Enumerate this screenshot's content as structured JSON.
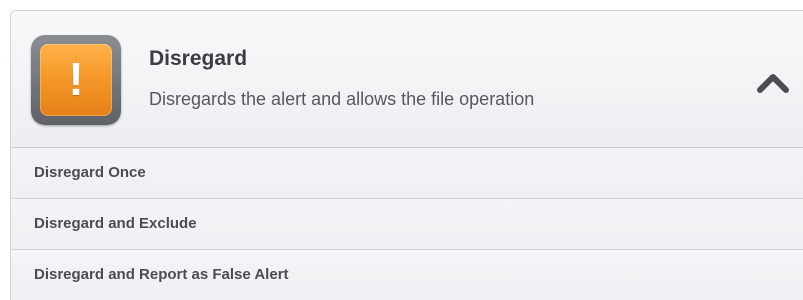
{
  "action": {
    "title": "Disregard",
    "description": "Disregards the alert and allows the file operation",
    "icon": "exclamation-warning-icon",
    "icon_glyph": "!",
    "expanded": true,
    "collapse_icon": "chevron-up-icon"
  },
  "options": [
    {
      "label": "Disregard Once"
    },
    {
      "label": "Disregard and Exclude"
    },
    {
      "label": "Disregard and Report as False Alert"
    }
  ],
  "colors": {
    "warning_orange": "#f59a2a",
    "icon_frame": "#6e7278",
    "text_dark": "#3a3d41",
    "panel_bg": "#f2f3f5"
  }
}
